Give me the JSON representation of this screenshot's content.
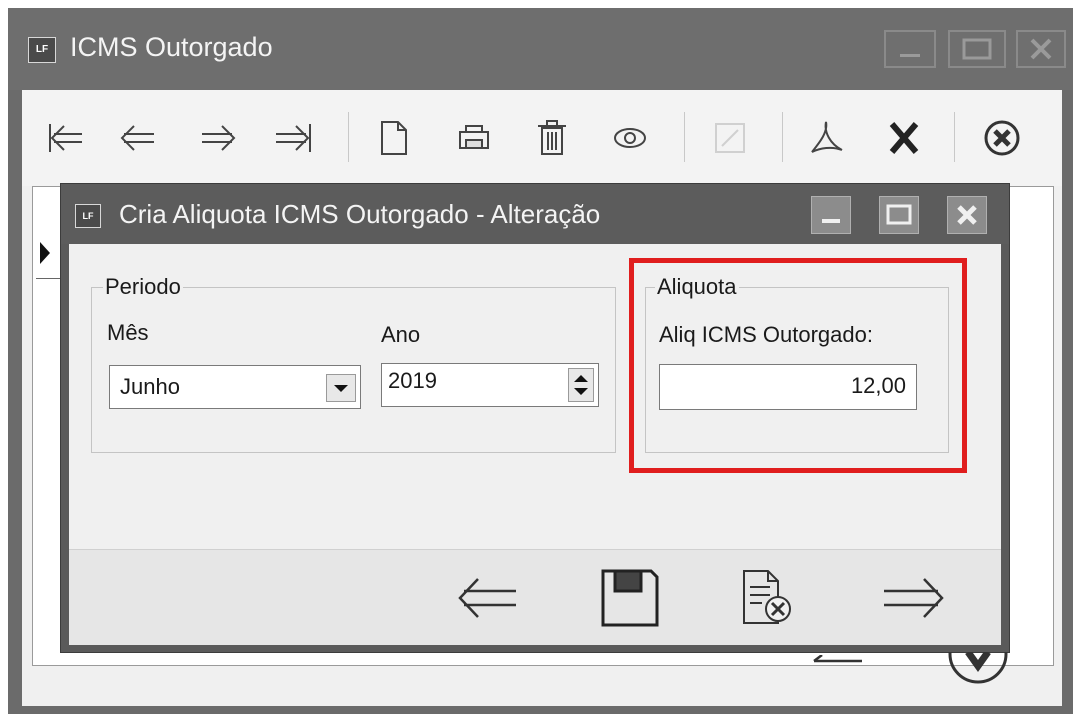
{
  "outer_window": {
    "icon_text": "LF",
    "title": "ICMS Outorgado"
  },
  "toolbar": {
    "icons": [
      "first-record-icon",
      "previous-record-icon",
      "next-record-icon",
      "last-record-icon",
      "new-document-icon",
      "print-icon",
      "delete-icon",
      "view-icon",
      "edit-icon",
      "pdf-icon",
      "excel-icon",
      "close-circle-icon"
    ]
  },
  "dialog": {
    "icon_text": "LF",
    "title": "Cria Aliquota ICMS Outorgado - Alteração",
    "periodo": {
      "legend": "Periodo",
      "mes_label": "Mês",
      "mes_value": "Junho",
      "ano_label": "Ano",
      "ano_value": "2019"
    },
    "aliquota": {
      "legend": "Aliquota",
      "field_label": "Aliq ICMS Outorgado:",
      "field_value": "12,00"
    },
    "footer_icons": [
      "previous-arrow-icon",
      "save-icon",
      "cancel-document-icon",
      "next-arrow-icon"
    ]
  },
  "colors": {
    "highlight": "#e01e1e",
    "titlebar": "#6e6e6e",
    "window_bg": "#f0f0f0"
  }
}
